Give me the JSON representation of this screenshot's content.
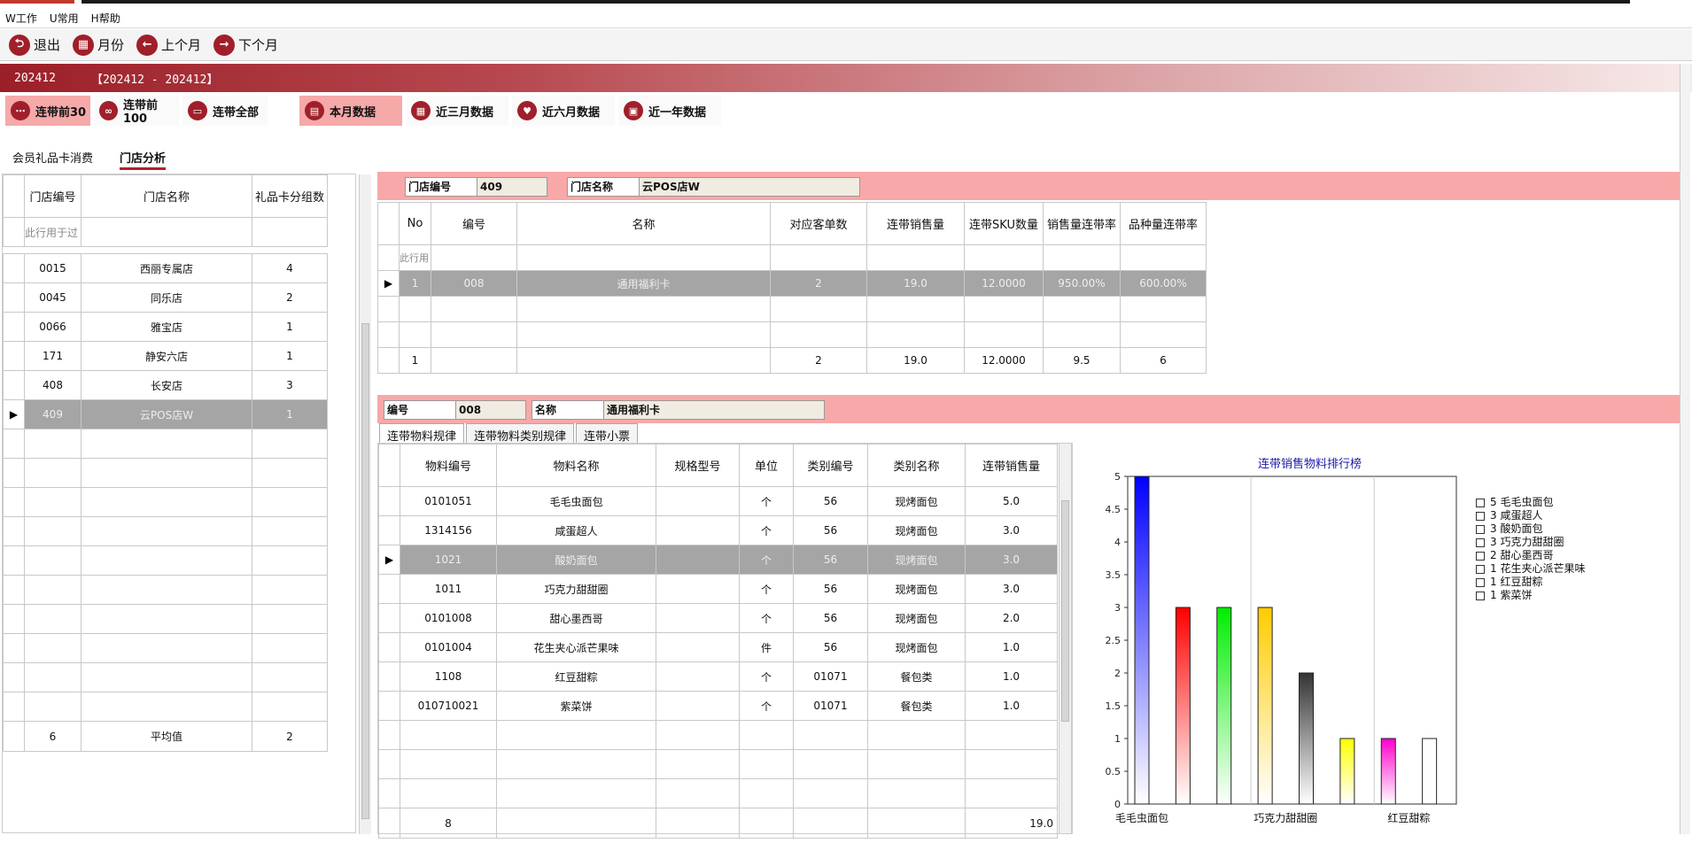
{
  "menu": [
    "W工作",
    "U常用",
    "H帮助"
  ],
  "toolbar": {
    "exit": "退出",
    "month": "月份",
    "prev": "上个月",
    "next": "下个月"
  },
  "banner": {
    "period": "202412",
    "range": "【202412 - 202412】"
  },
  "filters": {
    "top30": "连带前30",
    "top100": "连带前100",
    "all": "连带全部",
    "this_month": "本月数据",
    "three_months": "近三月数据",
    "six_months": "近六月数据",
    "one_year": "近一年数据"
  },
  "tabs": [
    "会员礼品卡消费",
    "门店分析"
  ],
  "stores": {
    "headers": [
      "门店编号",
      "门店名称",
      "礼品卡分组数"
    ],
    "filter_hint": "此行用于过",
    "rows": [
      [
        "0015",
        "西丽专属店",
        "4"
      ],
      [
        "0045",
        "同乐店",
        "2"
      ],
      [
        "0066",
        "雅宝店",
        "1"
      ],
      [
        "171",
        "静安六店",
        "1"
      ],
      [
        "408",
        "长安店",
        "3"
      ],
      [
        "409",
        "云POS店W",
        "1"
      ]
    ],
    "footer": [
      "6",
      "平均值",
      "2"
    ]
  },
  "store_info": {
    "code_label": "门店编号",
    "code": "409",
    "name_label": "门店名称",
    "name": "云POS店W"
  },
  "cards": {
    "headers": [
      "No",
      "编号",
      "名称",
      "对应客单数",
      "连带销售量",
      "连带SKU数量",
      "销售量连带率",
      "品种量连带率"
    ],
    "filter_hint": "此行用",
    "rows": [
      [
        "1",
        "008",
        "通用福利卡",
        "2",
        "19.0",
        "12.0000",
        "950.00%",
        "600.00%"
      ]
    ],
    "footer": [
      "1",
      "",
      "",
      "2",
      "19.0",
      "12.0000",
      "9.5",
      "6"
    ]
  },
  "card_info": {
    "code_label": "编号",
    "code": "008",
    "name_label": "名称",
    "name": "通用福利卡"
  },
  "subtabs": [
    "连带物料规律",
    "连带物料类别规律",
    "连带小票"
  ],
  "materials": {
    "headers": [
      "物料编号",
      "物料名称",
      "规格型号",
      "单位",
      "类别编号",
      "类别名称",
      "连带销售量"
    ],
    "rows": [
      [
        "0101051",
        "毛毛虫面包",
        "",
        "个",
        "56",
        "现烤面包",
        "5.0"
      ],
      [
        "1314156",
        "咸蛋超人",
        "",
        "个",
        "56",
        "现烤面包",
        "3.0"
      ],
      [
        "1021",
        "酸奶面包",
        "",
        "个",
        "56",
        "现烤面包",
        "3.0"
      ],
      [
        "1011",
        "巧克力甜甜圈",
        "",
        "个",
        "56",
        "现烤面包",
        "3.0"
      ],
      [
        "0101008",
        "甜心墨西哥",
        "",
        "个",
        "56",
        "现烤面包",
        "2.0"
      ],
      [
        "0101004",
        "花生夹心派芒果味",
        "",
        "件",
        "56",
        "现烤面包",
        "1.0"
      ],
      [
        "1108",
        "红豆甜粽",
        "",
        "个",
        "01071",
        "餐包类",
        "1.0"
      ],
      [
        "010710021",
        "紫菜饼",
        "",
        "个",
        "01071",
        "餐包类",
        "1.0"
      ]
    ],
    "footer": [
      "8",
      "",
      "",
      "",
      "",
      "",
      "19.0"
    ]
  },
  "chart_data": {
    "type": "bar",
    "title": "连带销售物料排行榜",
    "categories": [
      "毛毛虫面包",
      "咸蛋超人",
      "酸奶面包",
      "巧克力甜甜圈",
      "甜心墨西哥",
      "花生夹心派芒果味",
      "红豆甜粽",
      "紫菜饼"
    ],
    "values": [
      5,
      3,
      3,
      3,
      2,
      1,
      1,
      1
    ],
    "colors": [
      "#0000ff",
      "#ff0000",
      "#00ee00",
      "#ffcc00",
      "#333333",
      "#ffff00",
      "#ff00cc",
      "#ffffff"
    ],
    "ylim": [
      0,
      5
    ],
    "yticks": [
      "0",
      "0.5",
      "1",
      "1.5",
      "2",
      "2.5",
      "3",
      "3.5",
      "4",
      "4.5",
      "5"
    ],
    "xtick_labels": [
      "毛毛虫面包",
      "巧克力甜甜圈",
      "红豆甜粽"
    ],
    "legend": [
      "5 毛毛虫面包",
      "3 咸蛋超人",
      "3 酸奶面包",
      "3 巧克力甜甜圈",
      "2 甜心墨西哥",
      "1 花生夹心派芒果味",
      "1 红豆甜粽",
      "1 紫菜饼"
    ],
    "legend_position": "right"
  }
}
